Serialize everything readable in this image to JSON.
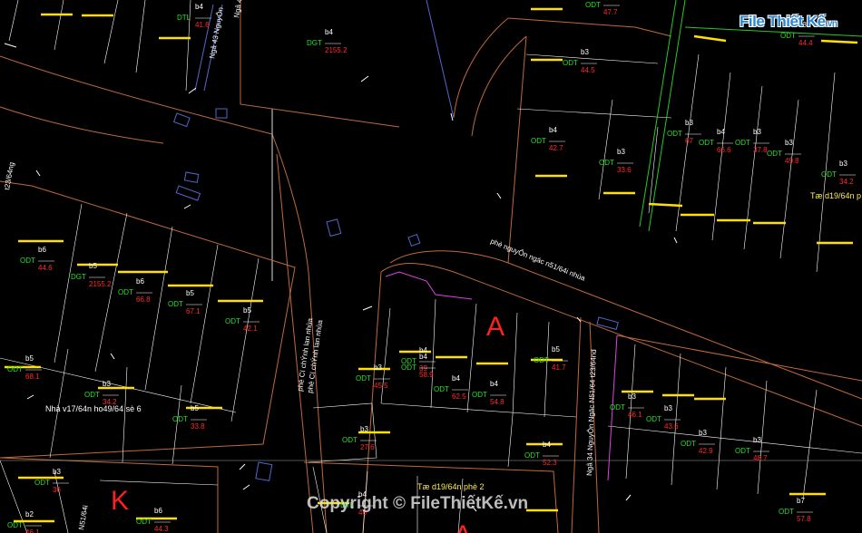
{
  "logo": {
    "text": "File Thiết Kế",
    "suffix": ".vn"
  },
  "watermark": {
    "text": "Copyright © FileThiếtKế.vn"
  },
  "roads": {
    "r1": "phè nguyÔn ngäc n51/64i nhùa",
    "r2": "Ngâ 43 NguyÔn",
    "r3": "phè Cï chÝnh lan nhùa",
    "r4": "phè Cï chÝnh lan nhùa",
    "r5": "Ngâ 34 NguyÔn Ngäc N51/64 t23/64nd",
    "r6": "N51/64i",
    "r7": "t23/64ng",
    "r8": "Ngâ 4"
  },
  "notes": {
    "n1": "Nhà v17/64n ho49/64 sè 6",
    "n2": "Tæ d19/64n phè 2",
    "n3": "Tæ d19/64n p"
  },
  "zones": {
    "a": "A",
    "k": "K",
    "a2": "A"
  },
  "parcel_codes": {
    "odt": "ODT",
    "dgt": "DGT",
    "dtl": "DTL"
  },
  "parcels": [
    {
      "lbl": "b4",
      "area": "41.6"
    },
    {
      "lbl": "b4",
      "area": "42.7"
    },
    {
      "lbl": "b3",
      "area": "33.6"
    },
    {
      "lbl": "b3",
      "area": "44.5"
    },
    {
      "lbl": "b5",
      "area": "47.7"
    },
    {
      "lbl": "b3",
      "area": "44.4"
    },
    {
      "lbl": "b3",
      "area": "67"
    },
    {
      "lbl": "b4",
      "area": "66.6"
    },
    {
      "lbl": "b3",
      "area": "37.8"
    },
    {
      "lbl": "b3",
      "area": "49.8"
    },
    {
      "lbl": "b3",
      "area": "34.2"
    },
    {
      "lbl": "b6",
      "area": "44.6"
    },
    {
      "lbl": "b5",
      "area": "2155.2"
    },
    {
      "lbl": "b6",
      "area": "66.8"
    },
    {
      "lbl": "b5",
      "area": "67.1"
    },
    {
      "lbl": "b5",
      "area": "42.1"
    },
    {
      "lbl": "b5",
      "area": "68.1"
    },
    {
      "lbl": "b3",
      "area": "34.2"
    },
    {
      "lbl": "b5",
      "area": "33.8"
    },
    {
      "lbl": "b4",
      "area": "39"
    },
    {
      "lbl": "b4",
      "area": "58.9"
    },
    {
      "lbl": "b4",
      "area": "62.5"
    },
    {
      "lbl": "b4",
      "area": "54.8"
    },
    {
      "lbl": "b5",
      "area": "41.7"
    },
    {
      "lbl": "b3",
      "area": "45.5"
    },
    {
      "lbl": "b3",
      "area": "27.6"
    },
    {
      "lbl": "b4",
      "area": "52.3"
    },
    {
      "lbl": "b3",
      "area": "46.1"
    },
    {
      "lbl": "b3",
      "area": "43.6"
    },
    {
      "lbl": "b3",
      "area": "42.9"
    },
    {
      "lbl": "b3",
      "area": "48.7"
    },
    {
      "lbl": "b7",
      "area": "57.8"
    },
    {
      "lbl": "b3",
      "area": "36"
    },
    {
      "lbl": "b6",
      "area": "44.3"
    },
    {
      "lbl": "b2",
      "area": "46.1"
    },
    {
      "lbl": "b4",
      "area": "2155.2"
    },
    {
      "lbl": "b4",
      "area": "46"
    }
  ]
}
